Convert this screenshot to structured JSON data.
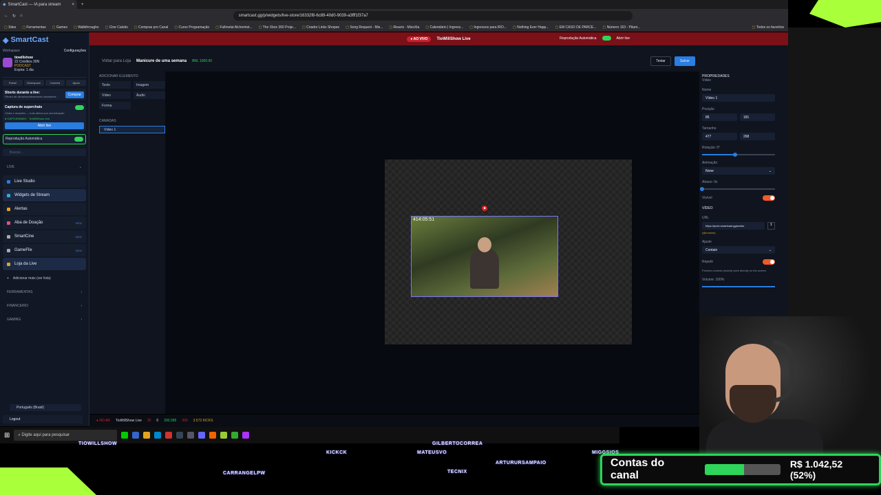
{
  "browser": {
    "tab_title": "SmartCast — IA para stream",
    "url": "smartcast.gg/p/widgets/live-store/16332f8-6c89-40d0-9039-a3fff1f37a7",
    "bookmarks": [
      "Sites",
      "Ferramentas",
      "Games",
      "Walkthroughs",
      "Cine Calvão",
      "Compras pro Canal",
      "Curso Programação",
      "Fullmetal Alchemist...",
      "The Xbox 360 Proje...",
      "Criador Links Shopee",
      "Song Request - Mis...",
      "Reacts - MissXta",
      "Calendário | Ingress...",
      "Ingressos para IRO...",
      "Nothing Ever Happ...",
      "EM CASO DE PARCE...",
      "Número 153 - Pilant..."
    ],
    "all_favorites": "Todos os favoritos"
  },
  "livebar": {
    "badge": "● AO VIVO",
    "channel": "TioWillShow Live",
    "autoplay": "Reprodução Automática",
    "open_live": "Abrir live"
  },
  "sidebar": {
    "logo": "SmartCast",
    "workspace_label": "Workspace",
    "settings": "Configurações",
    "user": "tiowillshow",
    "credits": "22 Créditos 30N",
    "podcast": "PODCAST",
    "expira": "Expira: 1 dia",
    "quick": [
      "Painel",
      "Workspace",
      "Carreira",
      "Ajuda"
    ],
    "shorts_title": "Shorts durante a live:",
    "shorts_sub": "Filmes de clima/monitoramento assistente",
    "comprar": "Comprar",
    "capture_title": "Captura de superchats",
    "capture_sub": "Chats e doações — tudo altera sua monetização",
    "capturing": "● CAPTURANDO · TioWillShow Live",
    "open_live_btn": "Abrir live",
    "autoplay": "Reprodução Automática",
    "search_placeholder": "Buscar...",
    "live_section": "LIVE",
    "nav": [
      {
        "label": "Live Studio",
        "new": ""
      },
      {
        "label": "Widgets de Stream",
        "new": ""
      },
      {
        "label": "Alertas",
        "new": ""
      },
      {
        "label": "Aba de Doação",
        "new": "NEW"
      },
      {
        "label": "SmartCine",
        "new": "NEW"
      },
      {
        "label": "GameFlix",
        "new": "NEW"
      },
      {
        "label": "Loja da Live",
        "new": ""
      }
    ],
    "add_more": "Adicionar mais (ver lista)",
    "sections": [
      "FERRAMENTAS",
      "FINANCEIRO",
      "GAMING"
    ],
    "language": "Português (Brasil)",
    "logout": "Logout"
  },
  "editor": {
    "back": "Voltar para Loja",
    "title": "Manicure de uma semana",
    "price": "BRL 1000.00",
    "test": "Testar",
    "save": "Salvar",
    "add_element": "ADICIONAR ELEMENTO",
    "elements": [
      "Texto",
      "Imagem",
      "Vídeo",
      "Áudio",
      "Forma"
    ],
    "layers": "CAMADAS",
    "layer_item": "Vídeo 1",
    "video_time": "414:05:51"
  },
  "props": {
    "title": "PROPRIEDADES",
    "subtitle": "Vídeo",
    "name_label": "Nome",
    "name": "Vídeo 1",
    "pos_label": "Posição",
    "x": "86",
    "y": "181",
    "size_label": "Tamanho",
    "w": "477",
    "h": "268",
    "rotation": "Rotação: 0°",
    "rotation_frac": 0.45,
    "animation_label": "Animação",
    "animation": "None",
    "delay": "Atraso: 0s",
    "delay_frac": 0.0,
    "visible": "Visível",
    "video_section": "VÍDEO",
    "url_label": "URL",
    "url": "https://pcdn.smartcast.gg/works",
    "upload_hint": "(@custom)",
    "fit_label": "Ajuste",
    "fit": "Contain",
    "repeat": "Repetir",
    "preview_note": "Preview controls (muted) work directly on the screen",
    "volume": "Volume: 100%",
    "volume_frac": 1.0
  },
  "statusbar": {
    "offline": "● NO AR",
    "channel": "TioWillShow Live",
    "a": "25",
    "b": "0",
    "c": "292.095",
    "d": "300",
    "e": "3.572 KICKS"
  },
  "taskbar": {
    "search": "Digite aqui para pesquisar"
  },
  "overlay": {
    "names": [
      "TIOWILLSHOW",
      "CARRANGELPW",
      "KICKCK",
      "MATEUSVO",
      "GILBERTOCORREA",
      "ARTURURSAMPAIO",
      "TECNIX",
      "MIGGSIOS"
    ]
  },
  "goal": {
    "label": "Contas do canal",
    "amount": "R$ 1.042,52",
    "percent": "(52%)",
    "fraction": 0.52
  },
  "colors": {
    "accent": "#2a7de1",
    "live_red": "#7a1018",
    "green": "#2fd45a",
    "toggle": "#f2592a"
  }
}
